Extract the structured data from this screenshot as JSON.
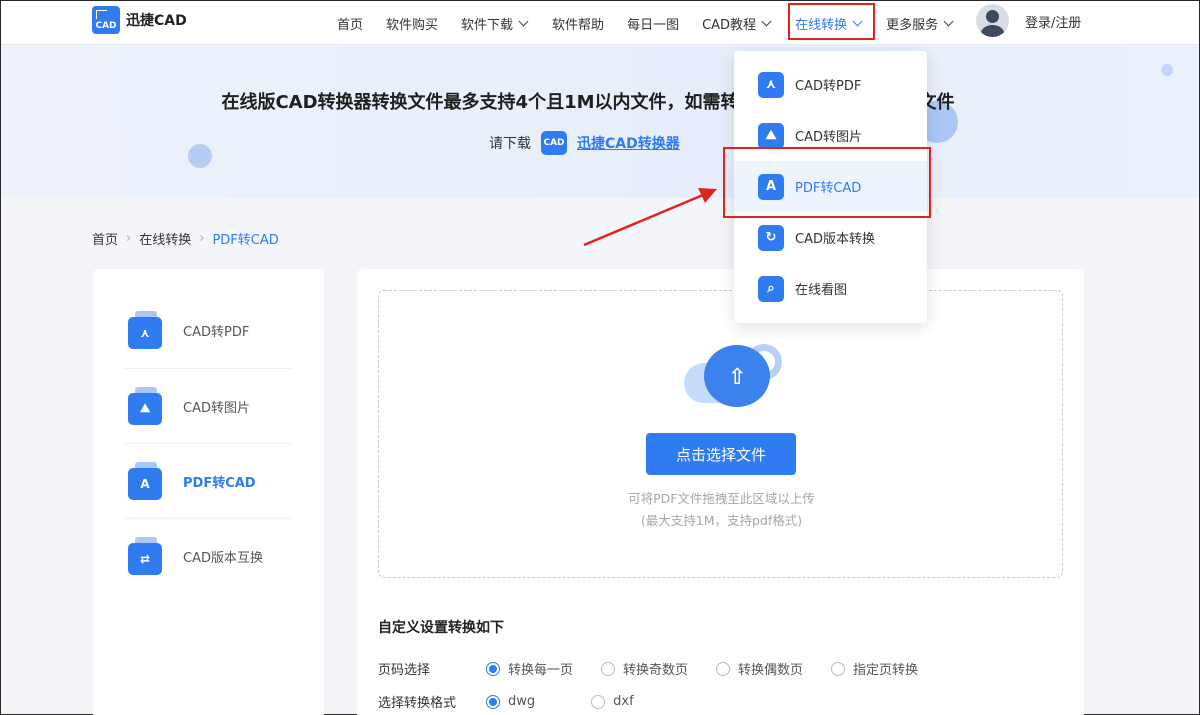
{
  "brand": {
    "logo_text": "CAD",
    "name": "迅捷CAD"
  },
  "nav": {
    "items": [
      {
        "label": "首页",
        "chevron": false
      },
      {
        "label": "软件购买",
        "chevron": false
      },
      {
        "label": "软件下载",
        "chevron": true
      },
      {
        "label": "软件帮助",
        "chevron": false
      },
      {
        "label": "每日一图",
        "chevron": false
      },
      {
        "label": "CAD教程",
        "chevron": true
      },
      {
        "label": "在线转换",
        "chevron": true,
        "active": true
      },
      {
        "label": "更多服务",
        "chevron": true
      }
    ],
    "login": "登录/注册"
  },
  "banner": {
    "title": "在线版CAD转换器转换文件最多支持4个且1M以内文件，如需转换更多文件或其他格式文件",
    "download_prefix": "请下载",
    "download_icon_text": "CAD",
    "download_link": "迅捷CAD转换器"
  },
  "breadcrumb": {
    "home": "首页",
    "section": "在线转换",
    "current": "PDF转CAD"
  },
  "sidebar": {
    "items": [
      {
        "label": "CAD转PDF",
        "icon": "cad-to-pdf-icon",
        "glyph": "⋏"
      },
      {
        "label": "CAD转图片",
        "icon": "cad-to-image-icon",
        "glyph": "⛰"
      },
      {
        "label": "PDF转CAD",
        "icon": "pdf-to-cad-icon",
        "glyph": "A",
        "active": true
      },
      {
        "label": "CAD版本互换",
        "icon": "cad-version-icon",
        "glyph": "⇄"
      }
    ]
  },
  "upload": {
    "button": "点击选择文件",
    "hint1": "可将PDF文件拖拽至此区域以上传",
    "hint2": "(最大支持1M，支持pdf格式)"
  },
  "settings": {
    "title": "自定义设置转换如下",
    "page_label": "页码选择",
    "page_options": [
      "转换每一页",
      "转换奇数页",
      "转换偶数页",
      "指定页转换"
    ],
    "page_selected": 0,
    "format_label": "选择转换格式",
    "format_options": [
      "dwg",
      "dxf"
    ],
    "format_selected": 0
  },
  "dropdown": {
    "items": [
      {
        "label": "CAD转PDF",
        "icon": "pdf-icon",
        "glyph": "⋏"
      },
      {
        "label": "CAD转图片",
        "icon": "image-icon",
        "glyph": "⛰"
      },
      {
        "label": "PDF转CAD",
        "icon": "pdf-to-cad-icon",
        "glyph": "A",
        "hover": true
      },
      {
        "label": "CAD版本转换",
        "icon": "refresh-icon",
        "glyph": "↻"
      },
      {
        "label": "在线看图",
        "icon": "search-icon",
        "glyph": "⌕"
      }
    ]
  },
  "colors": {
    "accent": "#2f7bf0",
    "highlight": "#e0231f"
  }
}
